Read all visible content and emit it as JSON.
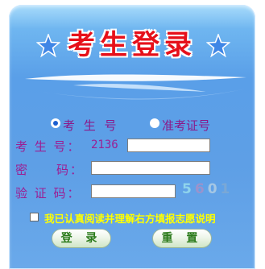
{
  "title": "考生登录",
  "login_type": {
    "options": [
      "考 生 号",
      "准考证号"
    ],
    "selected_index": 0
  },
  "form": {
    "candidate_label": "考 生 号：",
    "candidate_prefix": "2136",
    "candidate_value": "",
    "password_label": "密　　码：",
    "password_value": "",
    "captcha_label": "验 证 码：",
    "captcha_value": "",
    "captcha_text": "5601",
    "captcha_colors": [
      "#8fd4ec",
      "#9b93cc",
      "#a5c7e4",
      "#7aa8d6"
    ]
  },
  "agree": {
    "checked": false,
    "label": "我已认真阅读并理解右方填报志愿说明"
  },
  "buttons": {
    "login_label": "登 录",
    "reset_label": "重 置"
  },
  "colors": {
    "title": "#e6101a",
    "label": "#9b1f93",
    "agree_text": "#ffff00",
    "button_text": "#2a7a1a"
  }
}
